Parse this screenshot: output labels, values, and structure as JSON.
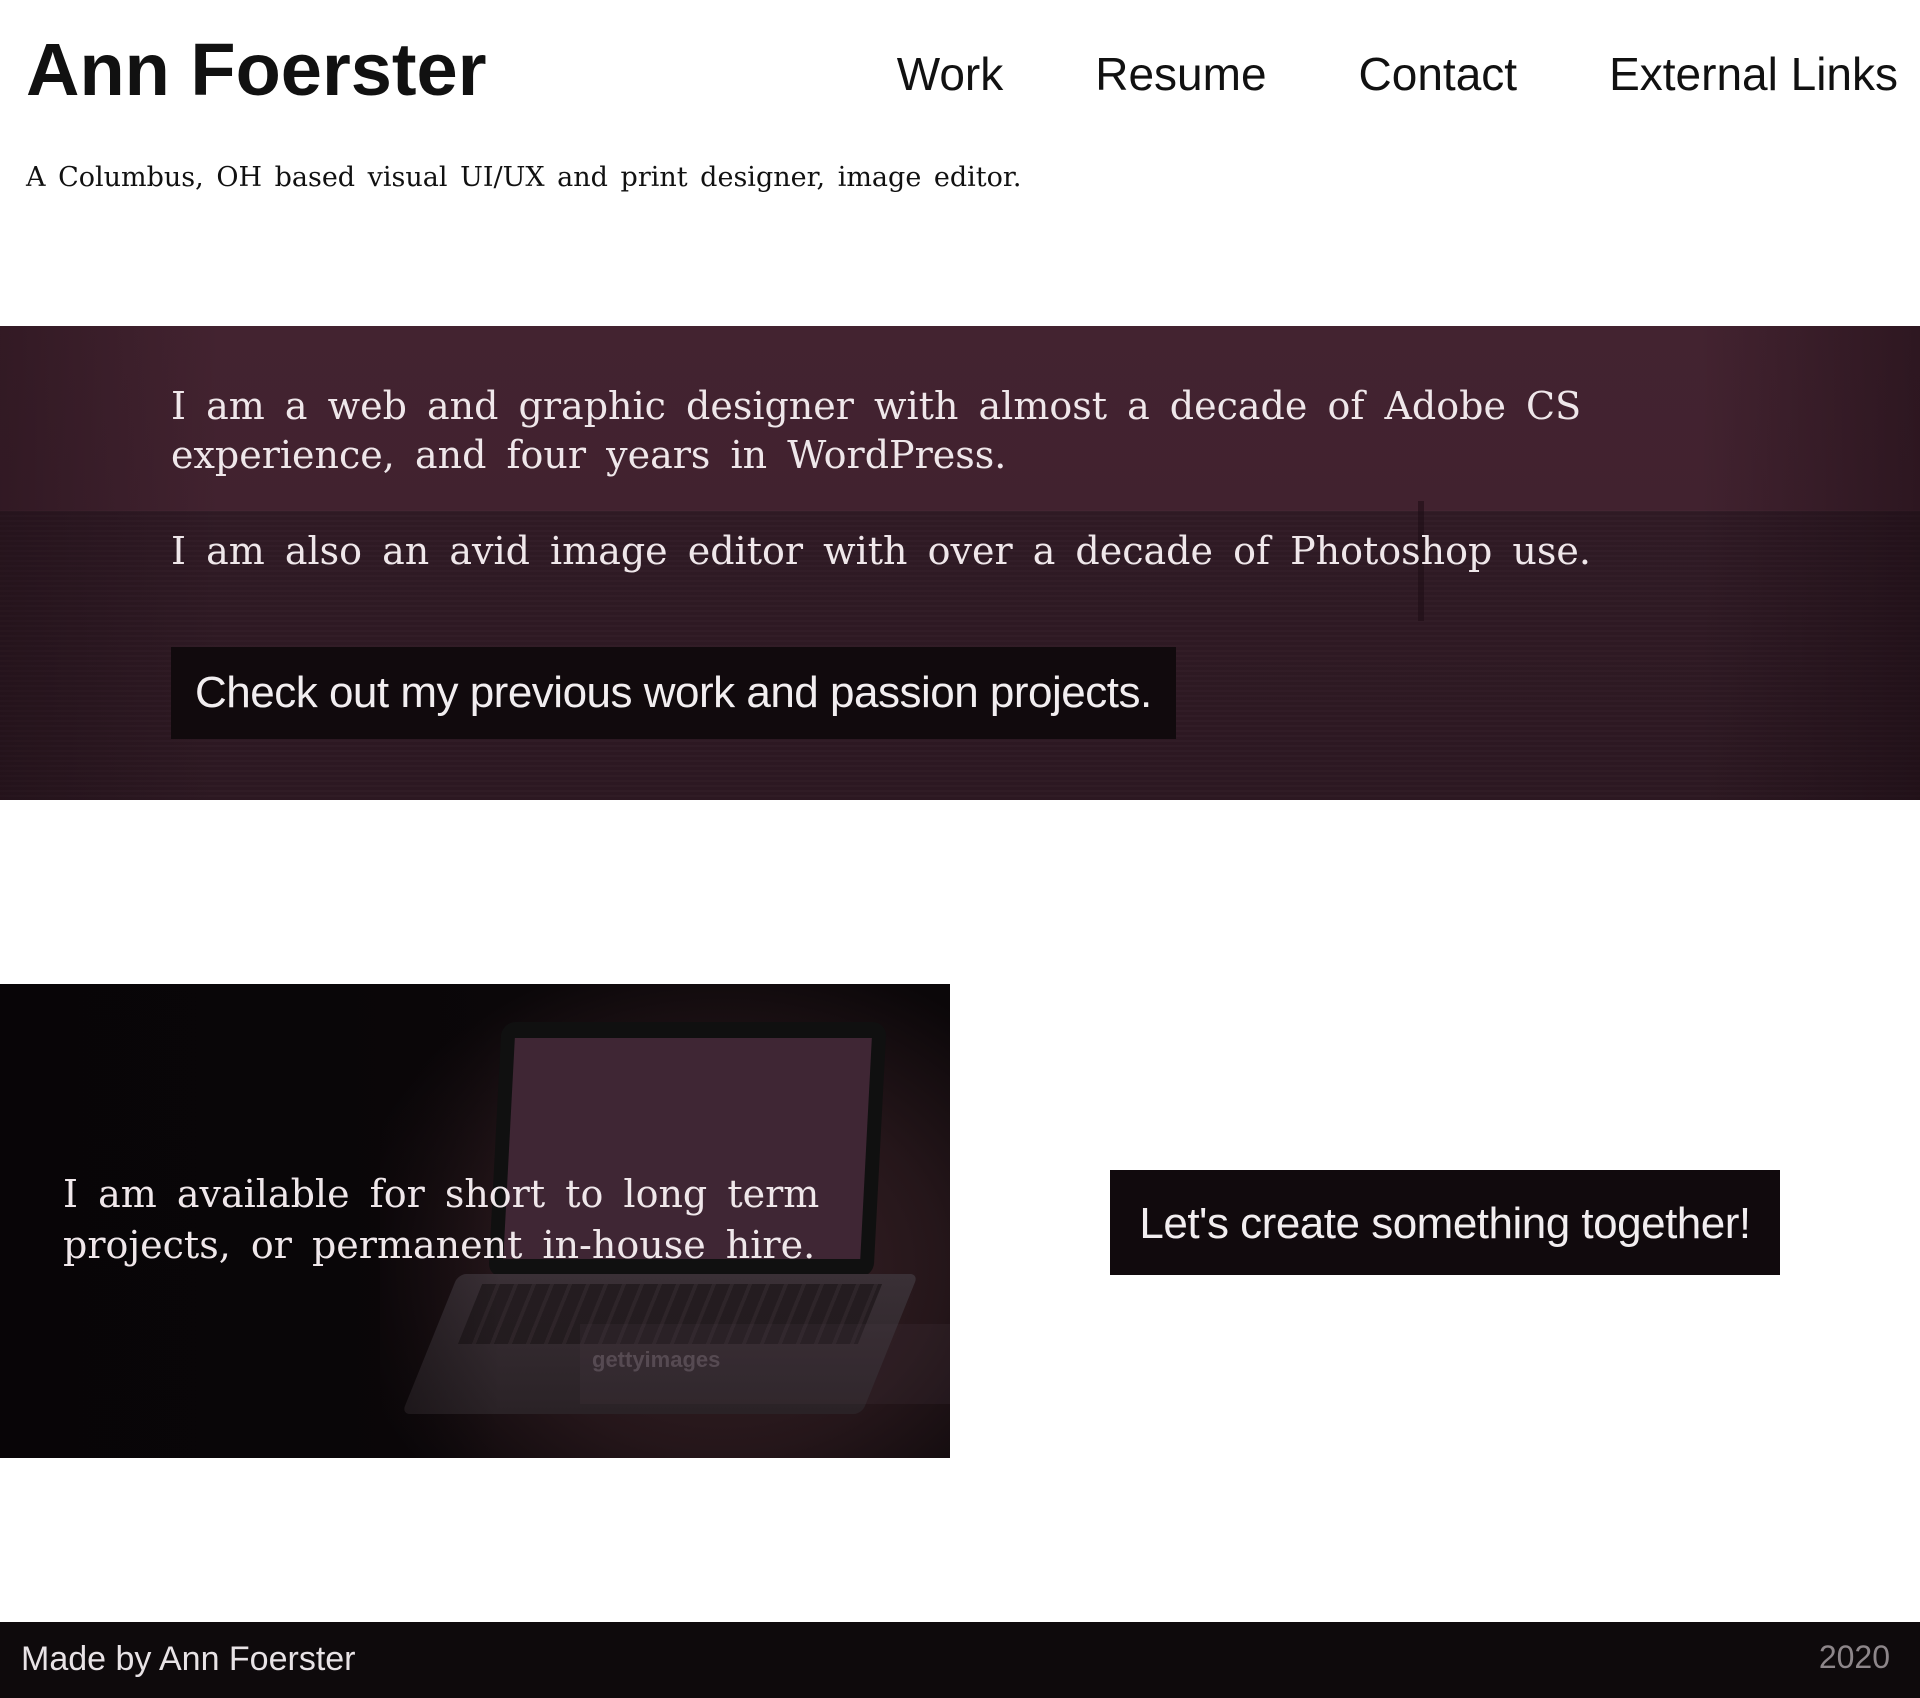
{
  "header": {
    "site_title": "Ann Foerster",
    "nav": [
      {
        "label": "Work"
      },
      {
        "label": "Resume"
      },
      {
        "label": "Contact"
      },
      {
        "label": "External Links"
      }
    ],
    "tagline": "A Columbus, OH based visual UI/UX and print designer, image editor."
  },
  "hero": {
    "paragraph_1": "I am a web and graphic designer with almost a decade of Adobe CS experience, and four years in WordPress.",
    "paragraph_2": "I am also an avid image editor with over a decade of Photoshop use.",
    "cta_label": "Check out my previous work and passion projects."
  },
  "availability": {
    "text": "I am available for short to long term projects, or permanent in-house hire.",
    "watermark": "gettyimages",
    "cta_label": "Let's create something together!"
  },
  "footer": {
    "made_by": "Made by Ann Foerster",
    "year": "2020"
  },
  "colors": {
    "hero_background": "#41222f",
    "button_background": "#110a0d",
    "footer_background": "#0e0a0c",
    "body_text": "#111111"
  }
}
